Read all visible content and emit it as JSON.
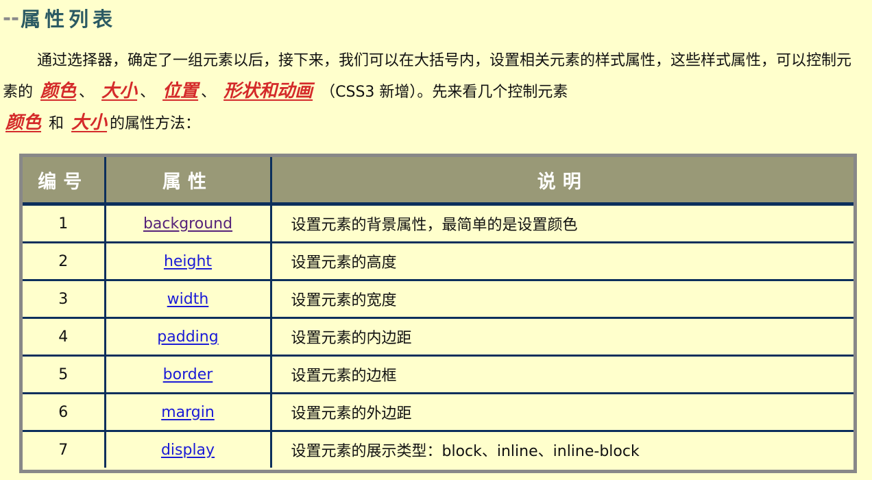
{
  "heading": {
    "prefix": "--",
    "title": "属性列表"
  },
  "intro": {
    "part1": "通过选择器，确定了一组元素以后，接下来，我们可以在大括号内，设置相关元素的样式属性，这些样式属性，可以控制元素的",
    "hl1": "颜色",
    "sep1": "、",
    "hl2": "大小",
    "sep2": "、",
    "hl3": "位置",
    "sep3": "、",
    "hl4": "形状和动画",
    "part2": "（CSS3 新增）。先来看几个控制元素",
    "hl5": "颜色",
    "part3": "和",
    "hl6": "大小",
    "part4": "的属性方法："
  },
  "table": {
    "headers": [
      "编号",
      "属性",
      "说明"
    ],
    "rows": [
      {
        "num": "1",
        "prop": "background",
        "desc": "设置元素的背景属性，最简单的是设置颜色"
      },
      {
        "num": "2",
        "prop": "height",
        "desc": "设置元素的高度"
      },
      {
        "num": "3",
        "prop": "width",
        "desc": "设置元素的宽度"
      },
      {
        "num": "4",
        "prop": "padding",
        "desc": "设置元素的内边距"
      },
      {
        "num": "5",
        "prop": "border",
        "desc": "设置元素的边框"
      },
      {
        "num": "6",
        "prop": "margin",
        "desc": "设置元素的外边距"
      },
      {
        "num": "7",
        "prop": "display",
        "desc": "设置元素的展示类型：block、inline、inline-block"
      }
    ]
  },
  "colors": {
    "background": "#ffffcc",
    "heading": "#2b5a63",
    "highlight": "#d42a2a",
    "table_header_bg": "#999977",
    "table_border": "#0c2f5c",
    "link": "#1a1ad6",
    "link_visited": "#55227a"
  }
}
